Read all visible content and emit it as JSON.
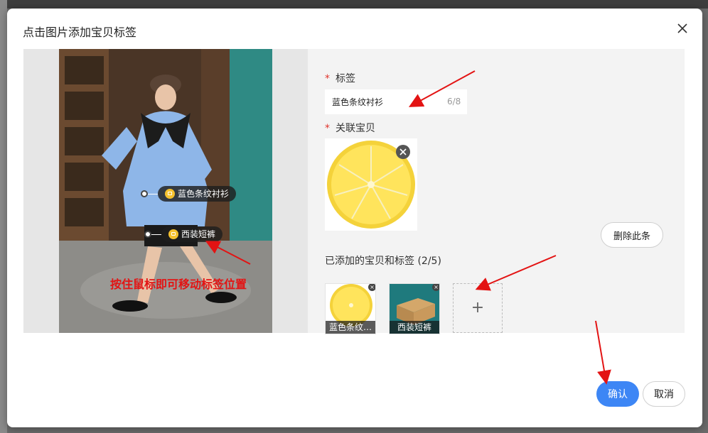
{
  "dialog": {
    "title": "点击图片添加宝贝标签",
    "close_icon": "close-icon"
  },
  "photo": {
    "tags": [
      {
        "label": "蓝色条纹衬衫",
        "icon": "lock-icon"
      },
      {
        "label": "西装短裤",
        "icon": "lock-icon"
      }
    ],
    "annotation": "按住鼠标即可移动标签位置"
  },
  "form": {
    "tag_label": "标签",
    "required_mark": "*",
    "tag_value": "蓝色条纹衬衫",
    "tag_counter": "6/8",
    "linked_label": "关联宝贝",
    "delete_button": "删除此条",
    "added_title": "已添加的宝贝和标签 (2/5)",
    "added_items": [
      {
        "caption": "蓝色条纹…",
        "remove_icon": "×"
      },
      {
        "caption": "西装短裤",
        "remove_icon": "×"
      }
    ],
    "add_icon": "+"
  },
  "footer": {
    "confirm": "确认",
    "cancel": "取消"
  },
  "colors": {
    "primary": "#3d86f5",
    "annotation": "#e31313",
    "required": "#e0342d"
  }
}
